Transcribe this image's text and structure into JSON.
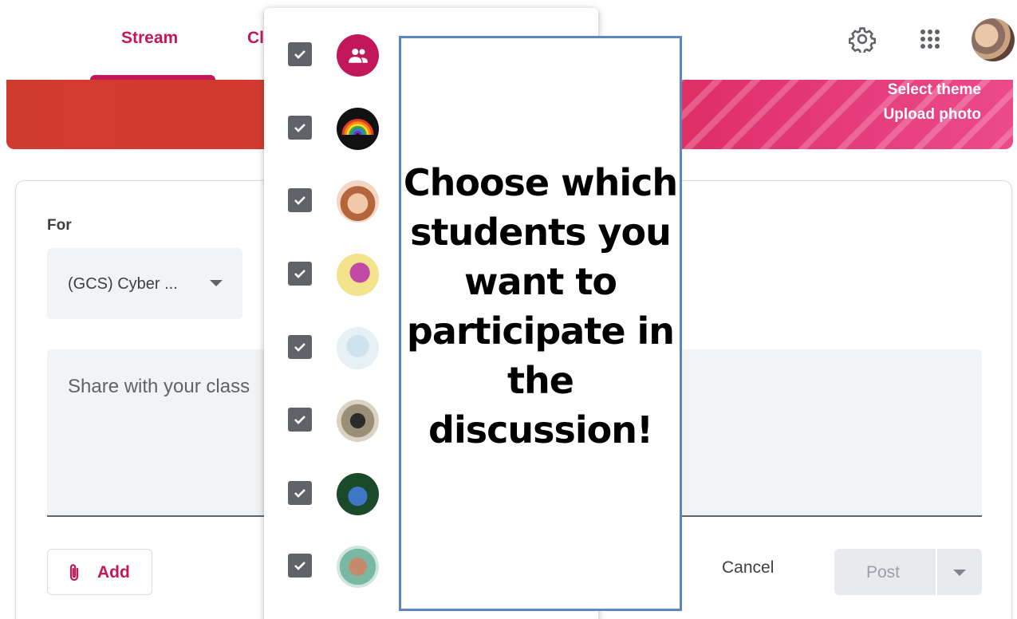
{
  "nav": {
    "tabs": [
      {
        "label": "Stream",
        "selected": true
      },
      {
        "label": "Classwork",
        "visible_fragment": "Cl"
      }
    ],
    "icons": [
      "gear-icon",
      "apps-grid-icon",
      "account-avatar"
    ]
  },
  "banner": {
    "select_theme": "Select theme",
    "upload_photo": "Upload photo"
  },
  "post_form": {
    "for_label": "For",
    "class_selected": "(GCS) Cyber ...",
    "share_placeholder": "Share with your class",
    "add_label": "Add",
    "cancel_label": "Cancel",
    "post_label": "Post"
  },
  "student_list": {
    "rows": [
      {
        "checked": true,
        "photo": "group-icon"
      },
      {
        "checked": true,
        "photo": "rainbow-photo"
      },
      {
        "checked": true,
        "photo": "emoji-photo"
      },
      {
        "checked": true,
        "photo": "character-photo"
      },
      {
        "checked": true,
        "photo": "snow-photo"
      },
      {
        "checked": true,
        "photo": "person-photo"
      },
      {
        "checked": true,
        "photo": "stitch-photo"
      },
      {
        "checked": true,
        "photo": "face-photo"
      }
    ]
  },
  "callout": {
    "text": "Choose which students you want to participate in the discussion!"
  },
  "colors": {
    "accent": "#c2185b",
    "banner_red": "#d13b2d",
    "banner_pink": "#ec4a8c",
    "callout_border": "#5b86c0",
    "checkbox": "#5f6368"
  }
}
